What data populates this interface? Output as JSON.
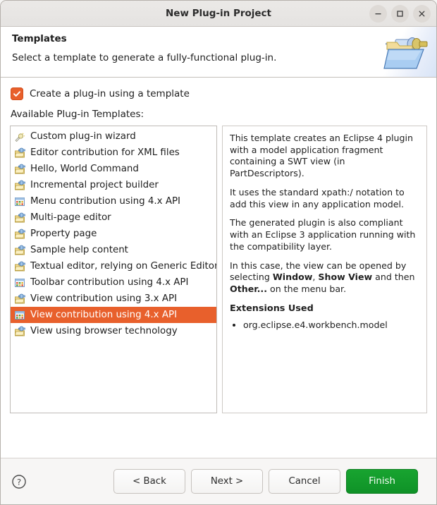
{
  "window": {
    "title": "New Plug-in Project",
    "controls": [
      {
        "name": "minimize",
        "glyph": "minimize-icon"
      },
      {
        "name": "maximize",
        "glyph": "maximize-icon"
      },
      {
        "name": "close",
        "glyph": "close-icon"
      }
    ]
  },
  "header": {
    "title": "Templates",
    "subtitle": "Select a template to generate a fully-functional plug-in.",
    "banner_icon": "plugin-folder-icon"
  },
  "options": {
    "use_template_label": "Create a plug-in using a template",
    "use_template_checked": true,
    "list_label": "Available Plug-in Templates:"
  },
  "templates": [
    {
      "label": "Custom plug-in wizard",
      "icon": "wizard-icon",
      "selected": false
    },
    {
      "label": "Editor contribution for XML files",
      "icon": "plugin-icon",
      "selected": false
    },
    {
      "label": "Hello, World Command",
      "icon": "plugin-icon",
      "selected": false
    },
    {
      "label": "Incremental project builder",
      "icon": "plugin-icon",
      "selected": false
    },
    {
      "label": "Menu contribution using 4.x API",
      "icon": "grid-icon",
      "selected": false
    },
    {
      "label": "Multi-page editor",
      "icon": "plugin-icon",
      "selected": false
    },
    {
      "label": "Property page",
      "icon": "plugin-icon",
      "selected": false
    },
    {
      "label": "Sample help content",
      "icon": "plugin-icon",
      "selected": false
    },
    {
      "label": "Textual editor, relying on Generic Editor",
      "icon": "plugin-icon",
      "selected": false
    },
    {
      "label": "Toolbar contribution using 4.x API",
      "icon": "grid-icon",
      "selected": false
    },
    {
      "label": "View contribution using 3.x API",
      "icon": "plugin-icon",
      "selected": false
    },
    {
      "label": "View contribution using 4.x API",
      "icon": "grid-icon",
      "selected": true
    },
    {
      "label": "View using browser technology",
      "icon": "plugin-icon",
      "selected": false
    }
  ],
  "description": {
    "paragraph1": "This template creates an Eclipse 4 plugin with a model application fragment containing a SWT view (in PartDescriptors).",
    "paragraph2": "It uses the standard xpath:/ notation to add this view in any application model.",
    "paragraph3": "The generated plugin is also compliant with an Eclipse 3 application running with the compatibility layer.",
    "paragraph4_prefix": "In this case, the view can be opened by selecting ",
    "paragraph4_bold1": "Window",
    "paragraph4_mid1": ", ",
    "paragraph4_bold2": "Show View",
    "paragraph4_mid2": " and then ",
    "paragraph4_bold3": "Other...",
    "paragraph4_suffix": " on the menu bar.",
    "extensions_heading": "Extensions Used",
    "extensions": [
      "org.eclipse.e4.workbench.model"
    ]
  },
  "footer": {
    "help_icon": "help-icon",
    "back_label": "< Back",
    "next_label": "Next >",
    "cancel_label": "Cancel",
    "finish_label": "Finish"
  },
  "colors": {
    "selection": "#e8602c",
    "checkbox": "#e8602c",
    "finish": "#12a02c"
  }
}
